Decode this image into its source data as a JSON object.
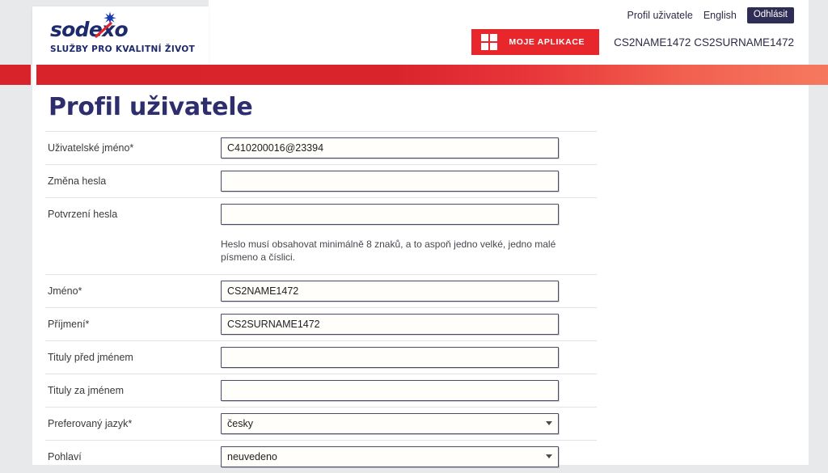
{
  "header": {
    "logo": {
      "wordmark": "sodexo",
      "tagline": "SLUŽBY PRO KVALITNÍ ŽIVOT",
      "brand_navy": "#1d2a6b",
      "brand_red": "#e8272c"
    },
    "nav_links": [
      {
        "label": "Profil uživatele"
      },
      {
        "label": "English"
      }
    ],
    "logout_label": "Odhlásit",
    "apps_button_label": "MOJE APLIKACE",
    "user_name": "CS2NAME1472 CS2SURNAME1472"
  },
  "accent_bar": {
    "from": "#d8232a",
    "to": "#f5795f"
  },
  "main": {
    "title": "Profil uživatele",
    "password_hint": "Heslo musí obsahovat minimálně 8 znaků, a to aspoň jedno velké, jedno malé písmeno a číslici.",
    "fields": [
      {
        "label": "Uživatelské jméno*",
        "value": "C410200016@23394",
        "placeholder": "",
        "type": "text"
      },
      {
        "label": "Změna hesla",
        "value": "",
        "placeholder": "",
        "type": "password"
      },
      {
        "label": "Potvrzení hesla",
        "value": "",
        "placeholder": "",
        "type": "password"
      },
      {
        "label": "Jméno*",
        "value": "CS2NAME1472",
        "placeholder": "",
        "type": "text"
      },
      {
        "label": "Příjmení*",
        "value": "CS2SURNAME1472",
        "placeholder": "",
        "type": "text"
      },
      {
        "label": "Tituly před jménem",
        "value": "",
        "placeholder": "",
        "type": "text"
      },
      {
        "label": "Tituly za jménem",
        "value": "",
        "placeholder": "",
        "type": "text"
      },
      {
        "label": "Preferovaný jazyk*",
        "value": "česky",
        "placeholder": "",
        "type": "select"
      },
      {
        "label": "Pohlaví",
        "value": "neuvedeno",
        "placeholder": "",
        "type": "select"
      }
    ]
  }
}
